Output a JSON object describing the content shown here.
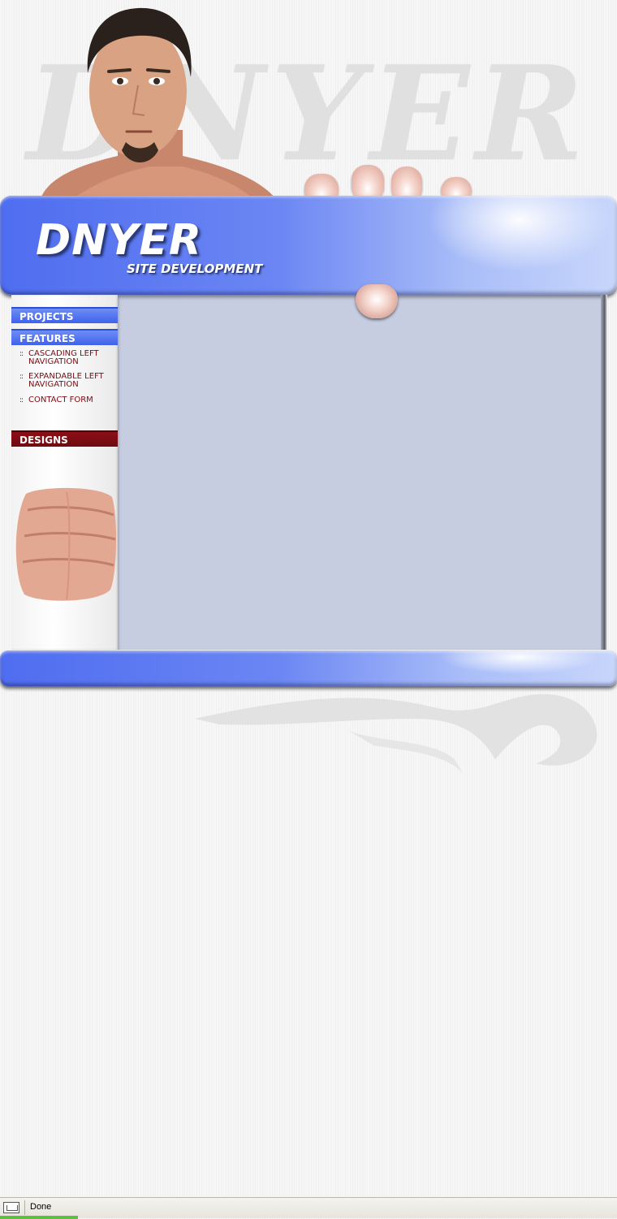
{
  "watermark": {
    "text": "DNYER"
  },
  "brand": {
    "title": "DNYER",
    "subtitle": "SITE DEVELOPMENT"
  },
  "nav": {
    "projects": "PROJECTS",
    "features": "FEATURES",
    "features_items": [
      {
        "bullet": "::",
        "label": "CASCADING LEFT NAVIGATION"
      },
      {
        "bullet": "::",
        "label": "EXPANDABLE LEFT NAVIGATION"
      },
      {
        "bullet": "::",
        "label": "CONTACT FORM"
      }
    ],
    "designs": "DESIGNS"
  },
  "status": {
    "text": "Done"
  },
  "colors": {
    "header_blue": "#4f6df0",
    "content_bg": "#c7cde0",
    "designs_red": "#7a0a10",
    "sub_link": "#7a0a10",
    "status_progress": "#5ac040"
  }
}
